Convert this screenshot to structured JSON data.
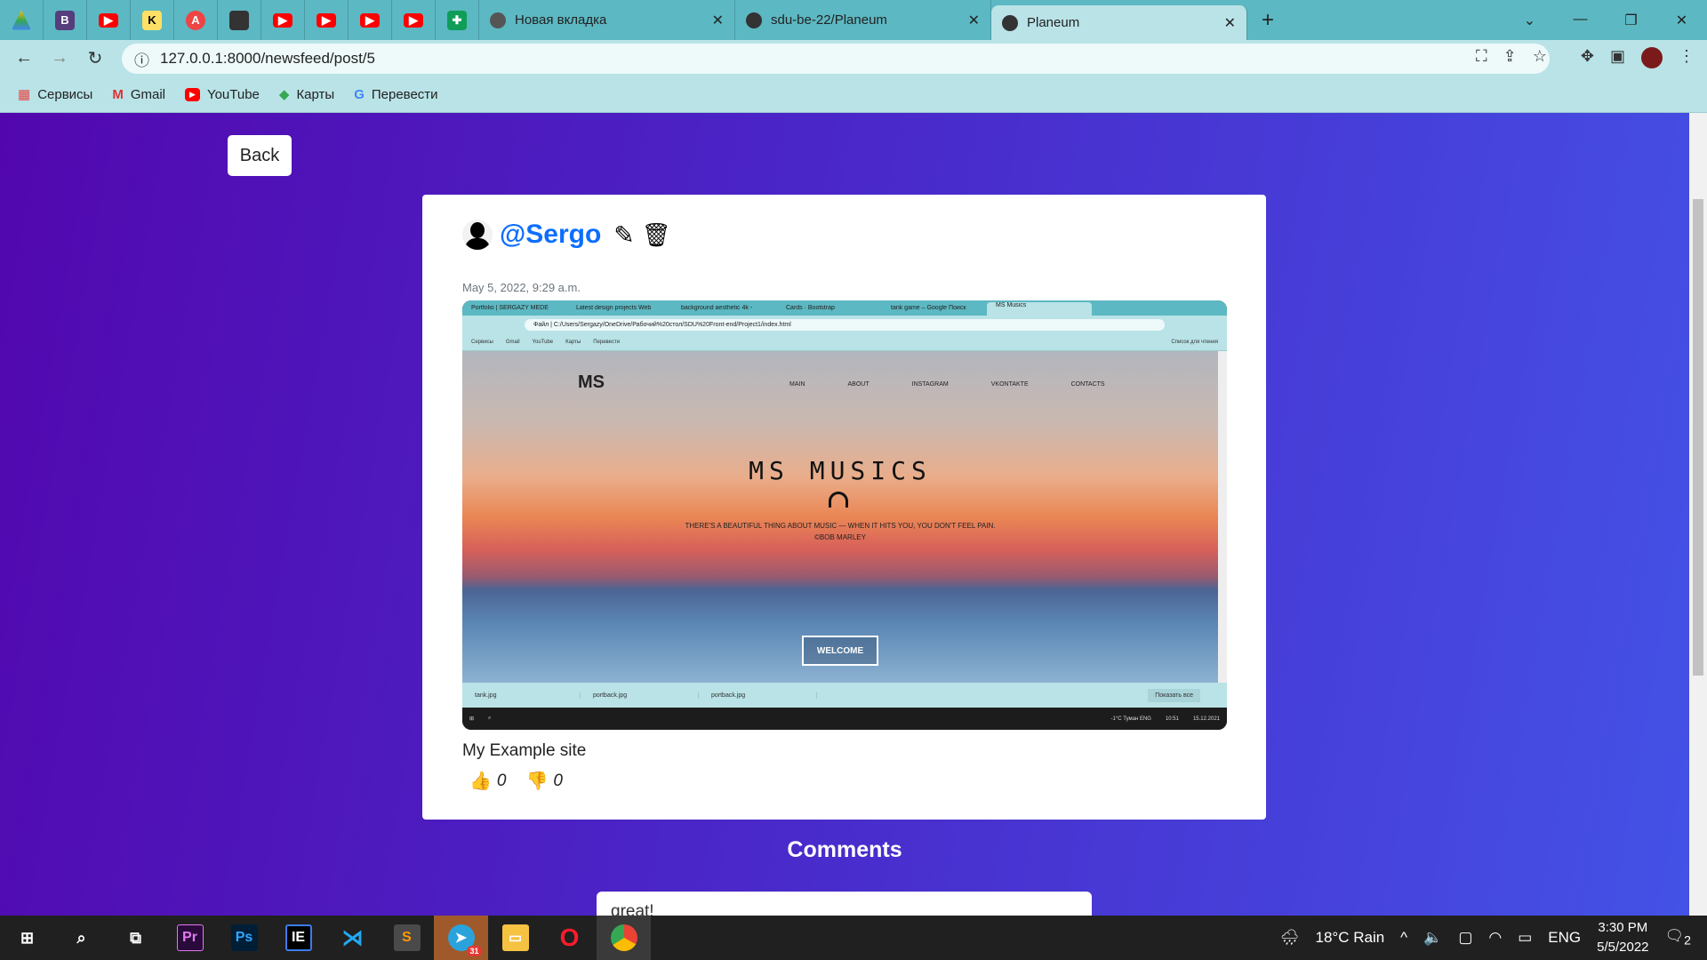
{
  "browser": {
    "tabs": [
      {
        "title": "Новая вкладка"
      },
      {
        "title": "sdu-be-22/Planeum"
      },
      {
        "title": "Planeum"
      }
    ],
    "url": "127.0.0.1:8000/newsfeed/post/5",
    "bookmarks": [
      "Сервисы",
      "Gmail",
      "YouTube",
      "Карты",
      "Перевести"
    ]
  },
  "page": {
    "back_label": "Back",
    "post": {
      "username": "@Sergo",
      "date": "May 5, 2022, 9:29 a.m.",
      "description": "My Example site",
      "likes": "0",
      "dislikes": "0",
      "screenshot": {
        "tabs": [
          "Portfolio | SERGAZY MEDE",
          "Latest design projects Web",
          "background aesthetic 4k -",
          "Cards · Bootstrap",
          "tank game – Google Поиск",
          "MS Musics"
        ],
        "url": "Файл | C:/Users/Sergazy/OneDrive/Рабочий%20стол/SDU%20Front-end/Project1/index.html",
        "bookmarks": [
          "Сервисы",
          "Gmail",
          "YouTube",
          "Карты",
          "Перевести"
        ],
        "reading_list": "Список для чтения",
        "logo": "MS",
        "menu": [
          "MAIN",
          "ABOUT",
          "INSTAGRAM",
          "VKONTAKTE",
          "CONTACTS"
        ],
        "title": "MS MUSICS",
        "quote": "THERE'S A BEAUTIFUL THING ABOUT MUSIC — WHEN IT HITS YOU, YOU DON'T FEEL PAIN.",
        "quote_author": "©BOB MARLEY",
        "button": "WELCOME",
        "downloads": [
          "tank.jpg",
          "portback.jpg",
          "portback.jpg"
        ],
        "show_all": "Показать все",
        "tray": "-1°C Туман   ENG",
        "time": "10:51",
        "date": "15.12.2021"
      }
    },
    "comments_heading": "Comments",
    "comments": [
      {
        "text": "great!"
      }
    ]
  },
  "taskbar": {
    "weather": "18°C Rain",
    "lang": "ENG",
    "time": "3:30 PM",
    "date": "5/5/2022",
    "notifications": "2",
    "telegram_badge": "31"
  }
}
